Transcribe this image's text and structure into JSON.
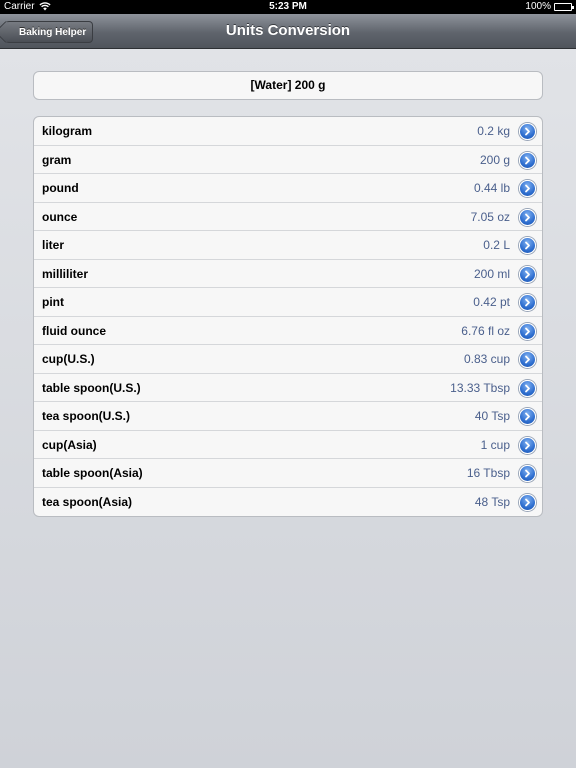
{
  "status": {
    "carrier": "Carrier",
    "time": "5:23 PM",
    "battery": "100%"
  },
  "nav": {
    "title": "Units Conversion",
    "back_label": "Baking Helper"
  },
  "header": {
    "text": "[Water] 200 g"
  },
  "rows": [
    {
      "unit": "kilogram",
      "value": "0.2 kg"
    },
    {
      "unit": "gram",
      "value": "200 g"
    },
    {
      "unit": "pound",
      "value": "0.44 lb"
    },
    {
      "unit": "ounce",
      "value": "7.05 oz"
    },
    {
      "unit": "liter",
      "value": "0.2 L"
    },
    {
      "unit": "milliliter",
      "value": "200 ml"
    },
    {
      "unit": "pint",
      "value": "0.42 pt"
    },
    {
      "unit": "fluid ounce",
      "value": "6.76 fl oz"
    },
    {
      "unit": "cup(U.S.)",
      "value": "0.83 cup"
    },
    {
      "unit": "table spoon(U.S.)",
      "value": "13.33 Tbsp"
    },
    {
      "unit": "tea spoon(U.S.)",
      "value": "40 Tsp"
    },
    {
      "unit": "cup(Asia)",
      "value": "1 cup"
    },
    {
      "unit": "table spoon(Asia)",
      "value": "16 Tbsp"
    },
    {
      "unit": "tea spoon(Asia)",
      "value": "48 Tsp"
    }
  ],
  "icons": {
    "row_action": "chevron-right-disclosure-icon",
    "wifi": "wifi-icon",
    "battery": "battery-icon"
  },
  "colors": {
    "value_text": "#4a5f8c",
    "disclosure_blue": "#2f6fd0",
    "nav_bar": "#5f646c"
  }
}
